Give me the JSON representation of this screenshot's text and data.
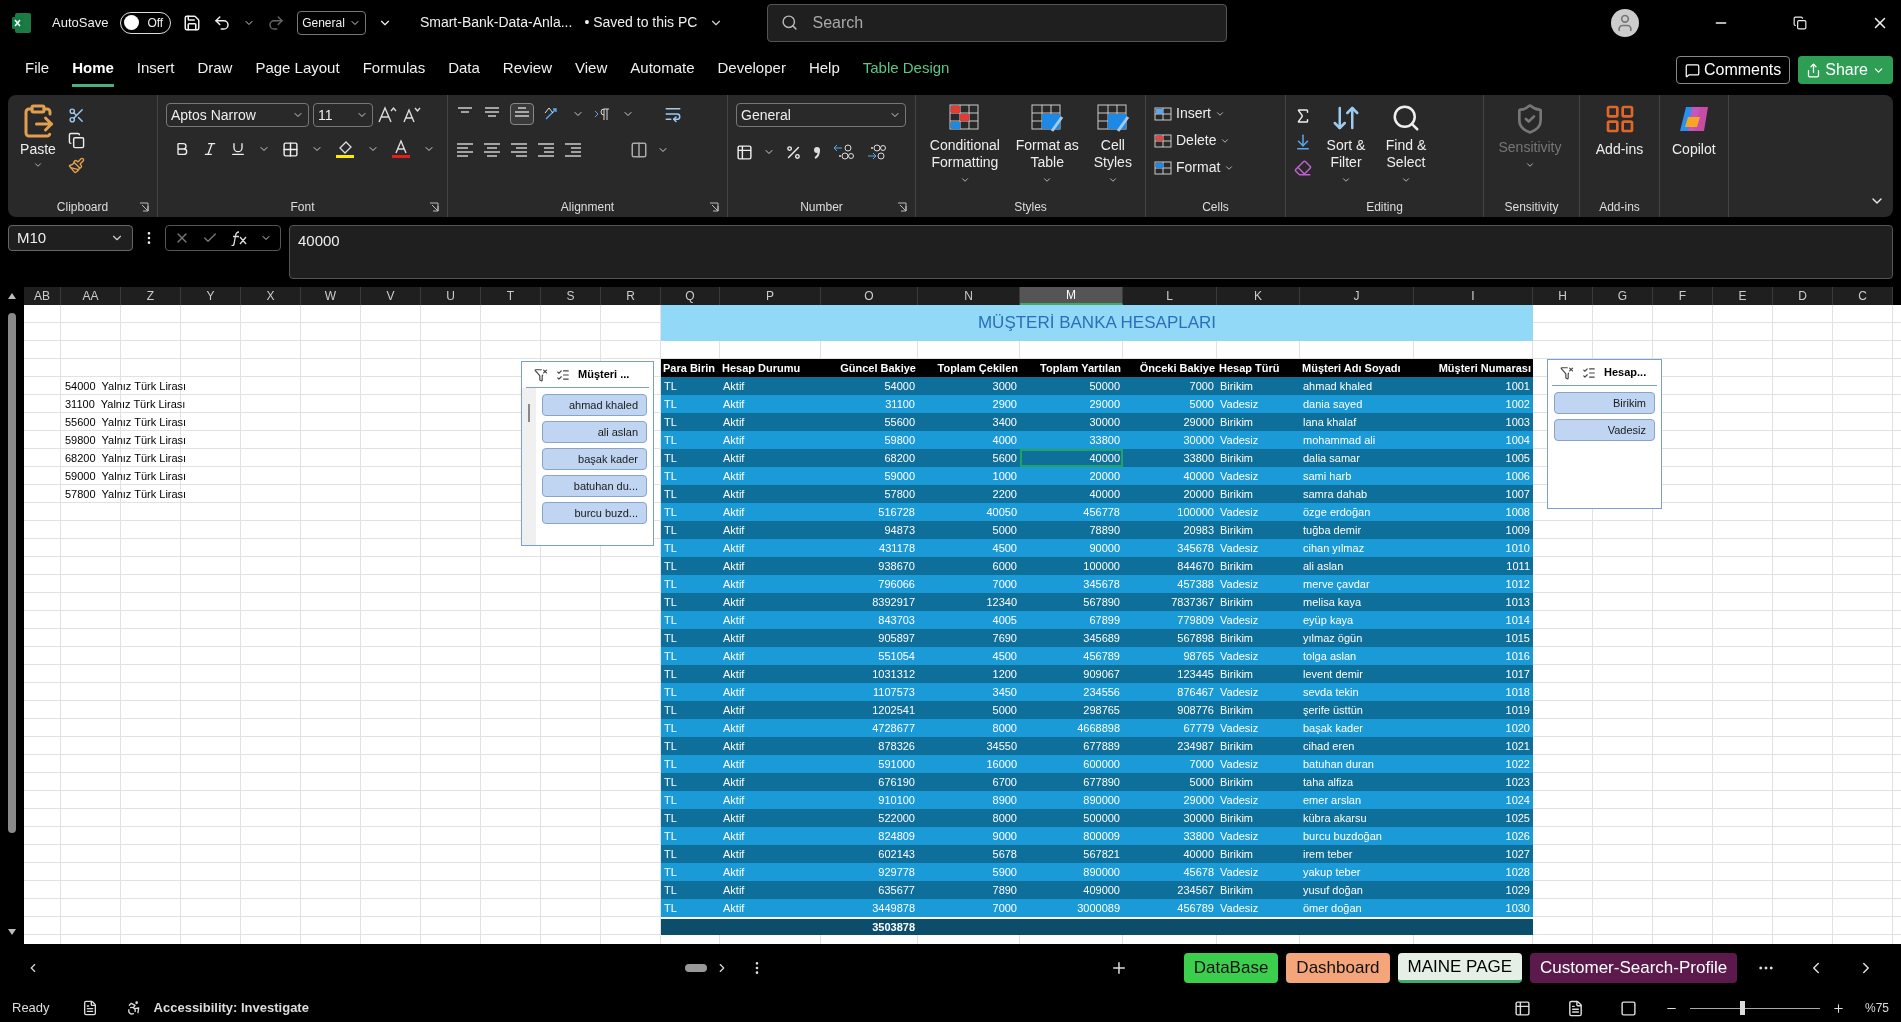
{
  "title_bar": {
    "autosave": {
      "label": "AutoSave",
      "on": false,
      "state_text": "Off"
    },
    "style_box": "General",
    "file_name": "Smart-Bank-Data-Anla...",
    "save_status": "• Saved to this PC",
    "search": {
      "placeholder": "Search"
    }
  },
  "menu_tabs": [
    {
      "label": "File",
      "selected": false,
      "kind": "normal"
    },
    {
      "label": "Home",
      "selected": true,
      "kind": "normal"
    },
    {
      "label": "Insert",
      "selected": false,
      "kind": "normal"
    },
    {
      "label": "Draw",
      "selected": false,
      "kind": "normal"
    },
    {
      "label": "Page Layout",
      "selected": false,
      "kind": "normal"
    },
    {
      "label": "Formulas",
      "selected": false,
      "kind": "normal"
    },
    {
      "label": "Data",
      "selected": false,
      "kind": "normal"
    },
    {
      "label": "Review",
      "selected": false,
      "kind": "normal"
    },
    {
      "label": "View",
      "selected": false,
      "kind": "normal"
    },
    {
      "label": "Automate",
      "selected": false,
      "kind": "normal"
    },
    {
      "label": "Developer",
      "selected": false,
      "kind": "normal"
    },
    {
      "label": "Help",
      "selected": false,
      "kind": "normal"
    },
    {
      "label": "Table Design",
      "selected": false,
      "kind": "contextual"
    }
  ],
  "header_buttons": {
    "comments": "Comments",
    "share": "Share"
  },
  "ribbon": {
    "clipboard": {
      "label": "Clipboard",
      "paste": "Paste"
    },
    "font": {
      "label": "Font",
      "font_name": "Aptos Narrow",
      "font_size": "11"
    },
    "alignment": {
      "label": "Alignment"
    },
    "number": {
      "label": "Number",
      "format": "General"
    },
    "styles": {
      "label": "Styles",
      "buttons": [
        "Conditional Formatting",
        "Format as Table",
        "Cell Styles"
      ]
    },
    "cells": {
      "label": "Cells",
      "buttons": [
        "Insert",
        "Delete",
        "Format"
      ]
    },
    "editing": {
      "label": "Editing",
      "buttons": [
        "Sort & Filter",
        "Find & Select"
      ]
    },
    "sensitivity": {
      "label": "Sensitivity",
      "button": "Sensitivity",
      "disabled": true
    },
    "addins": {
      "label": "Add-ins",
      "button": "Add-ins"
    },
    "copilot": {
      "button": "Copilot"
    }
  },
  "formula_bar": {
    "name_box": "M10",
    "value": "40000"
  },
  "columns": [
    {
      "label": "AB",
      "selected": false
    },
    {
      "label": "AA",
      "selected": false
    },
    {
      "label": "Z",
      "selected": false
    },
    {
      "label": "Y",
      "selected": false
    },
    {
      "label": "X",
      "selected": false
    },
    {
      "label": "W",
      "selected": false
    },
    {
      "label": "V",
      "selected": false
    },
    {
      "label": "U",
      "selected": false
    },
    {
      "label": "T",
      "selected": false
    },
    {
      "label": "S",
      "selected": false
    },
    {
      "label": "R",
      "selected": false
    },
    {
      "label": "Q",
      "selected": false
    },
    {
      "label": "P",
      "selected": false
    },
    {
      "label": "O",
      "selected": false
    },
    {
      "label": "N",
      "selected": false
    },
    {
      "label": "M",
      "selected": true
    },
    {
      "label": "L",
      "selected": false
    },
    {
      "label": "K",
      "selected": false
    },
    {
      "label": "J",
      "selected": false
    },
    {
      "label": "I",
      "selected": false
    },
    {
      "label": "H",
      "selected": false
    },
    {
      "label": "G",
      "selected": false
    },
    {
      "label": "F",
      "selected": false
    },
    {
      "label": "E",
      "selected": false
    },
    {
      "label": "D",
      "selected": false
    },
    {
      "label": "C",
      "selected": false
    }
  ],
  "side_list": [
    {
      "amount": "54000",
      "words": "Yalnız Türk Lirası"
    },
    {
      "amount": "31100",
      "words": "Yalnız Türk Lirası"
    },
    {
      "amount": "55600",
      "words": "Yalnız Türk Lirası"
    },
    {
      "amount": "59800",
      "words": "Yalnız Türk Lirası"
    },
    {
      "amount": "68200",
      "words": "Yalnız Türk Lirası"
    },
    {
      "amount": "59000",
      "words": "Yalnız Türk Lirası"
    },
    {
      "amount": "57800",
      "words": "Yalnız Türk Lirası"
    }
  ],
  "table": {
    "title": "MÜŞTERİ BANKA HESAPLARI",
    "columns": [
      "Para Birin",
      "Hesap Durumu",
      "Güncel Bakiye",
      "Toplam Çekilen",
      "Toplam Yartılan",
      "Önceki Bakiye",
      "Hesap Türü",
      "Müşteri Adı Soyadı",
      "Müşteri Numarası"
    ],
    "rows": [
      {
        "cells": [
          "TL",
          "Aktif",
          "54000",
          "3000",
          "50000",
          "7000",
          "Birikim",
          "ahmad khaled",
          "1001"
        ],
        "selected": false
      },
      {
        "cells": [
          "TL",
          "Aktif",
          "31100",
          "2900",
          "29000",
          "5000",
          "Vadesiz",
          "dania sayed",
          "1002"
        ],
        "selected": false
      },
      {
        "cells": [
          "TL",
          "Aktif",
          "55600",
          "3400",
          "30000",
          "29000",
          "Birikim",
          "lana khalaf",
          "1003"
        ],
        "selected": false
      },
      {
        "cells": [
          "TL",
          "Aktif",
          "59800",
          "4000",
          "33800",
          "30000",
          "Vadesiz",
          "mohammad ali",
          "1004"
        ],
        "selected": false
      },
      {
        "cells": [
          "TL",
          "Aktif",
          "68200",
          "5600",
          "40000",
          "33800",
          "Birikim",
          "dalia samar",
          "1005"
        ],
        "selected": true
      },
      {
        "cells": [
          "TL",
          "Aktif",
          "59000",
          "1000",
          "20000",
          "40000",
          "Vadesiz",
          "sami harb",
          "1006"
        ],
        "selected": false
      },
      {
        "cells": [
          "TL",
          "Aktif",
          "57800",
          "2200",
          "40000",
          "20000",
          "Birikim",
          "samra dahab",
          "1007"
        ],
        "selected": false
      },
      {
        "cells": [
          "TL",
          "Aktif",
          "516728",
          "40050",
          "456778",
          "100000",
          "Vadesiz",
          "özge erdoğan",
          "1008"
        ],
        "selected": false
      },
      {
        "cells": [
          "TL",
          "Aktif",
          "94873",
          "5000",
          "78890",
          "20983",
          "Birikim",
          "tuğba demir",
          "1009"
        ],
        "selected": false
      },
      {
        "cells": [
          "TL",
          "Aktif",
          "431178",
          "4500",
          "90000",
          "345678",
          "Vadesiz",
          "cihan yılmaz",
          "1010"
        ],
        "selected": false
      },
      {
        "cells": [
          "TL",
          "Aktif",
          "938670",
          "6000",
          "100000",
          "844670",
          "Birikim",
          "ali aslan",
          "1011"
        ],
        "selected": false
      },
      {
        "cells": [
          "TL",
          "Aktif",
          "796066",
          "7000",
          "345678",
          "457388",
          "Vadesiz",
          "merve çavdar",
          "1012"
        ],
        "selected": false
      },
      {
        "cells": [
          "TL",
          "Aktif",
          "8392917",
          "12340",
          "567890",
          "7837367",
          "Birikim",
          "melisa kaya",
          "1013"
        ],
        "selected": false
      },
      {
        "cells": [
          "TL",
          "Aktif",
          "843703",
          "4005",
          "67899",
          "779809",
          "Vadesiz",
          "eyüp kaya",
          "1014"
        ],
        "selected": false
      },
      {
        "cells": [
          "TL",
          "Aktif",
          "905897",
          "7690",
          "345689",
          "567898",
          "Birikim",
          "yılmaz ögün",
          "1015"
        ],
        "selected": false
      },
      {
        "cells": [
          "TL",
          "Aktif",
          "551054",
          "4500",
          "456789",
          "98765",
          "Vadesiz",
          "tolga aslan",
          "1016"
        ],
        "selected": false
      },
      {
        "cells": [
          "TL",
          "Aktif",
          "1031312",
          "1200",
          "909067",
          "123445",
          "Birikim",
          "levent demir",
          "1017"
        ],
        "selected": false
      },
      {
        "cells": [
          "TL",
          "Aktif",
          "1107573",
          "3450",
          "234556",
          "876467",
          "Vadesiz",
          "sevda tekin",
          "1018"
        ],
        "selected": false
      },
      {
        "cells": [
          "TL",
          "Aktif",
          "1202541",
          "5000",
          "298765",
          "908776",
          "Birikim",
          "şerife üsttün",
          "1019"
        ],
        "selected": false
      },
      {
        "cells": [
          "TL",
          "Aktif",
          "4728677",
          "8000",
          "4668898",
          "67779",
          "Vadesiz",
          "başak kader",
          "1020"
        ],
        "selected": false
      },
      {
        "cells": [
          "TL",
          "Aktif",
          "878326",
          "34550",
          "677889",
          "234987",
          "Birikim",
          "cihad eren",
          "1021"
        ],
        "selected": false
      },
      {
        "cells": [
          "TL",
          "Aktif",
          "591000",
          "16000",
          "600000",
          "7000",
          "Vadesiz",
          "batuhan duran",
          "1022"
        ],
        "selected": false
      },
      {
        "cells": [
          "TL",
          "Aktif",
          "676190",
          "6700",
          "677890",
          "5000",
          "Birikim",
          "taha alfiza",
          "1023"
        ],
        "selected": false
      },
      {
        "cells": [
          "TL",
          "Aktif",
          "910100",
          "8900",
          "890000",
          "29000",
          "Vadesiz",
          "emer arslan",
          "1024"
        ],
        "selected": false
      },
      {
        "cells": [
          "TL",
          "Aktif",
          "522000",
          "8000",
          "500000",
          "30000",
          "Birikim",
          "kübra akarsu",
          "1025"
        ],
        "selected": false
      },
      {
        "cells": [
          "TL",
          "Aktif",
          "824809",
          "9000",
          "800009",
          "33800",
          "Vadesiz",
          "burcu buzdoğan",
          "1026"
        ],
        "selected": false
      },
      {
        "cells": [
          "TL",
          "Aktif",
          "602143",
          "5678",
          "567821",
          "40000",
          "Birikim",
          "irem teber",
          "1027"
        ],
        "selected": false
      },
      {
        "cells": [
          "TL",
          "Aktif",
          "929778",
          "5900",
          "890000",
          "45678",
          "Vadesiz",
          "yakup teber",
          "1028"
        ],
        "selected": false
      },
      {
        "cells": [
          "TL",
          "Aktif",
          "635677",
          "7890",
          "409000",
          "234567",
          "Birikim",
          "yusuf doğan",
          "1029"
        ],
        "selected": false
      },
      {
        "cells": [
          "TL",
          "Aktif",
          "3449878",
          "7000",
          "3000089",
          "456789",
          "Vadesiz",
          "ömer doğan",
          "1030"
        ],
        "selected": false
      }
    ],
    "total": "3503878"
  },
  "slicers": [
    {
      "title": "Müşteri ...",
      "items": [
        {
          "label": "ahmad khaled",
          "selected": true
        },
        {
          "label": "ali aslan",
          "selected": true
        },
        {
          "label": "başak kader",
          "selected": true
        },
        {
          "label": "batuhan du...",
          "selected": true
        },
        {
          "label": "burcu buzd...",
          "selected": true
        }
      ]
    },
    {
      "title": "Hesap...",
      "items": [
        {
          "label": "Birikim",
          "selected": true
        },
        {
          "label": "Vadesiz",
          "selected": true
        }
      ]
    }
  ],
  "sheet_tabs": [
    {
      "label": "DataBase",
      "selected": false,
      "color": "#3ccf4e"
    },
    {
      "label": "Dashboard",
      "selected": false,
      "color": "#f4a57a"
    },
    {
      "label": "MAINE PAGE",
      "selected": true,
      "color": "#e6efe6"
    },
    {
      "label": "Customer-Search-Profile",
      "selected": false,
      "color": "#5c1a4c"
    }
  ],
  "status_bar": {
    "ready": "Ready",
    "accessibility": "Accessibility: Investigate",
    "zoom": {
      "level": 0.4,
      "reading": "%75"
    }
  }
}
